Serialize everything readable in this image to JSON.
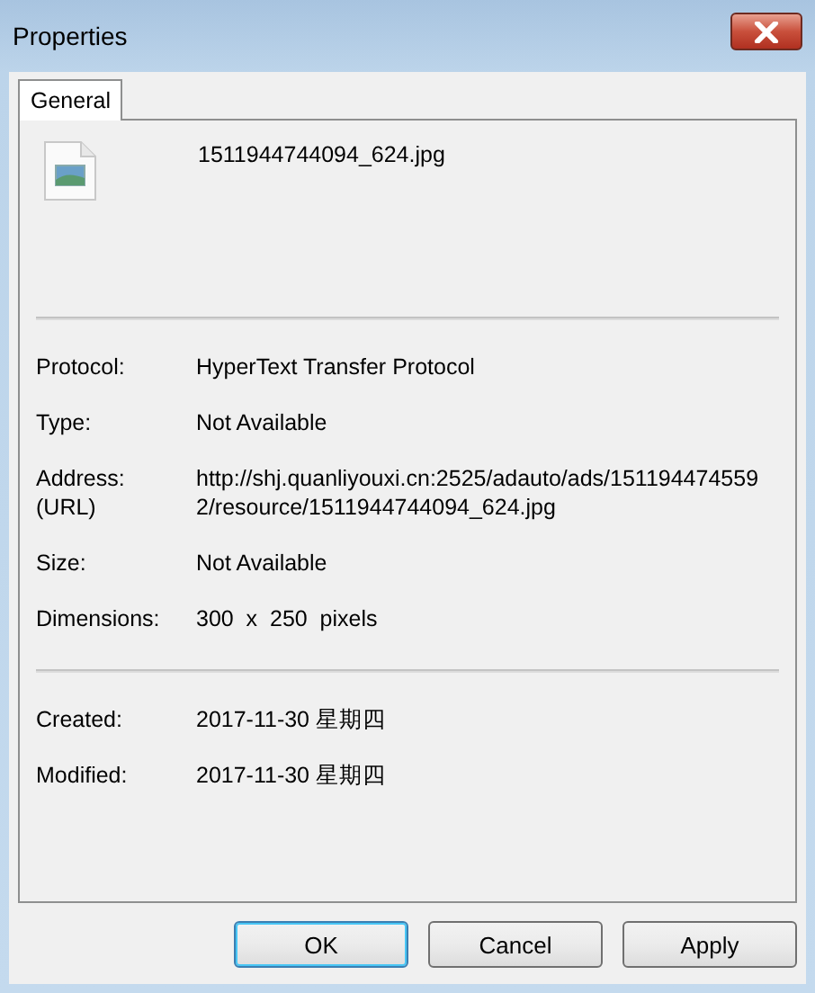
{
  "window": {
    "title": "Properties"
  },
  "tabs": [
    {
      "label": "General",
      "selected": true
    }
  ],
  "file_name": "1511944744094_624.jpg",
  "sections": [
    {
      "rows": [
        {
          "label": "Protocol:",
          "value": "HyperText Transfer Protocol"
        },
        {
          "label": "Type:",
          "value": "Not Available"
        },
        {
          "label": "Address:\n(URL)",
          "value": "http://shj.quanliyouxi.cn:2525/adauto/ads/1511944745592/resource/1511944744094_624.jpg"
        },
        {
          "label": "Size:",
          "value": "Not Available"
        },
        {
          "label": "Dimensions:",
          "value": "300  x  250  pixels"
        }
      ]
    },
    {
      "rows": [
        {
          "label": "Created:",
          "value": "2017-11-30 星期四"
        },
        {
          "label": "Modified:",
          "value": "2017-11-30 星期四"
        }
      ]
    }
  ],
  "buttons": [
    {
      "label": "OK",
      "default": true
    },
    {
      "label": "Cancel",
      "default": false
    },
    {
      "label": "Apply",
      "default": false
    }
  ]
}
